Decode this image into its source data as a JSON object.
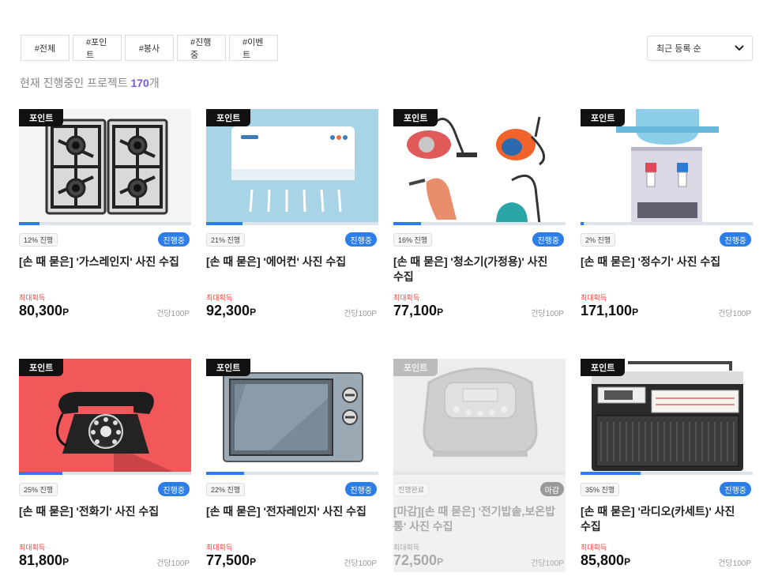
{
  "filters": [
    "#전체",
    "#포인트",
    "#봉사",
    "#진행중",
    "#이벤트"
  ],
  "sort": {
    "selected": "최근 등록 순"
  },
  "summary": {
    "prefix": "현재 진행중인 프로젝트 ",
    "count": "170",
    "suffix": "개"
  },
  "accent": "#7b57d9",
  "progress_color": "#2b7de9",
  "cards": [
    {
      "badge": "포인트",
      "progress": 12,
      "pct_label": "12% 진행",
      "status": "진행중",
      "title": "[손 때 묻은] '가스레인지' 사진 수집",
      "max_label": "최대획득",
      "price": "80,300",
      "unit": "P",
      "per": "건당100P",
      "image": "gas-range"
    },
    {
      "badge": "포인트",
      "progress": 21,
      "pct_label": "21% 진행",
      "status": "진행중",
      "title": "[손 때 묻은] '에어컨' 사진 수집",
      "max_label": "최대획득",
      "price": "92,300",
      "unit": "P",
      "per": "건당100P",
      "image": "air-conditioner"
    },
    {
      "badge": "포인트",
      "progress": 16,
      "pct_label": "16% 진행",
      "status": "진행중",
      "title": "[손 때 묻은] '청소기(가정용)' 사진 수집",
      "max_label": "최대획득",
      "price": "77,100",
      "unit": "P",
      "per": "건당100P",
      "image": "vacuum-cleaners"
    },
    {
      "badge": "포인트",
      "progress": 2,
      "pct_label": "2% 진행",
      "status": "진행중",
      "title": "[손 때 묻은] '정수기' 사진 수집",
      "max_label": "최대획득",
      "price": "171,100",
      "unit": "P",
      "per": "건당100P",
      "image": "water-dispenser"
    },
    {
      "badge": "포인트",
      "progress": 25,
      "pct_label": "25% 진행",
      "status": "진행중",
      "title": "[손 때 묻은] '전화기' 사진 수집",
      "max_label": "최대획득",
      "price": "81,800",
      "unit": "P",
      "per": "건당100P",
      "image": "rotary-phone"
    },
    {
      "badge": "포인트",
      "progress": 22,
      "pct_label": "22% 진행",
      "status": "진행중",
      "title": "[손 때 묻은] '전자레인지' 사진 수집",
      "max_label": "최대획득",
      "price": "77,500",
      "unit": "P",
      "per": "건당100P",
      "image": "microwave"
    },
    {
      "badge": "포인트",
      "progress": 0,
      "pct_label": "진행완료",
      "status": "마감",
      "title": "[마감][손 때 묻은] '전기밥솥,보온밥통' 사진 수집",
      "max_label": "최대획득",
      "price": "72,500",
      "unit": "P",
      "per": "건당100P",
      "image": "rice-cooker",
      "closed": true
    },
    {
      "badge": "포인트",
      "progress": 35,
      "pct_label": "35% 진행",
      "status": "진행중",
      "title": "[손 때 묻은] '라디오(카세트)' 사진 수집",
      "max_label": "최대획득",
      "price": "85,800",
      "unit": "P",
      "per": "건당100P",
      "image": "radio"
    }
  ]
}
